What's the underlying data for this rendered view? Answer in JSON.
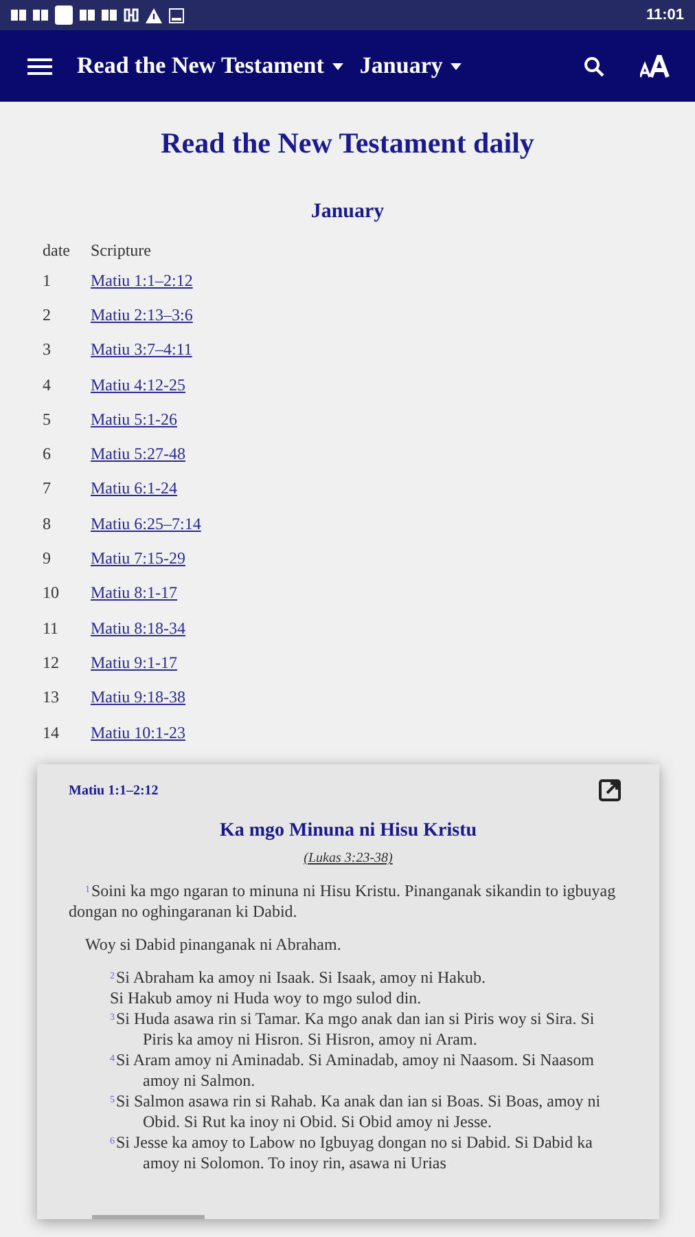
{
  "status_bar": {
    "time": "11:01"
  },
  "app_bar": {
    "title": "Read the New Testament",
    "month": "January"
  },
  "page": {
    "title": "Read the New Testament daily",
    "month": "January",
    "columns": [
      "date",
      "Scripture"
    ],
    "rows": [
      {
        "date": "1",
        "scripture": "Matiu 1:1–2:12"
      },
      {
        "date": "2",
        "scripture": "Matiu 2:13–3:6"
      },
      {
        "date": "3",
        "scripture": "Matiu 3:7–4:11"
      },
      {
        "date": "4",
        "scripture": "Matiu 4:12-25"
      },
      {
        "date": "5",
        "scripture": "Matiu 5:1-26"
      },
      {
        "date": "6",
        "scripture": "Matiu 5:27-48"
      },
      {
        "date": "7",
        "scripture": "Matiu 6:1-24"
      },
      {
        "date": "8",
        "scripture": "Matiu 6:25–7:14"
      },
      {
        "date": "9",
        "scripture": "Matiu 7:15-29"
      },
      {
        "date": "10",
        "scripture": "Matiu 8:1-17"
      },
      {
        "date": "11",
        "scripture": "Matiu 8:18-34"
      },
      {
        "date": "12",
        "scripture": "Matiu 9:1-17"
      },
      {
        "date": "13",
        "scripture": "Matiu 9:18-38"
      },
      {
        "date": "14",
        "scripture": "Matiu 10:1-23"
      }
    ]
  },
  "popup": {
    "reference": "Matiu 1:1–2:12",
    "heading": "Ka mgo Minuna ni Hisu Kristu",
    "cross_reference": "(Lukas 3:23-38)",
    "blocks": [
      {
        "kind": "paragraph",
        "verse": "1",
        "text": "Soini ka mgo ngaran to minuna ni Hisu Kristu. Pinanganak sikandin to igbuyag dongan no oghingaranan ki Dabid."
      },
      {
        "kind": "paragraph",
        "text": "Woy si Dabid pinanganak ni Abraham."
      },
      {
        "kind": "poetry",
        "verse": "2",
        "text": "Si Abraham ka amoy ni Isaak. Si Isaak, amoy ni Hakub."
      },
      {
        "kind": "poetry",
        "text": "Si Hakub amoy ni Huda woy to mgo sulod din."
      },
      {
        "kind": "poetry",
        "verse": "3",
        "text": "Si Huda asawa rin si Tamar. Ka mgo anak dan ian si Piris woy si Sira. Si Piris ka amoy ni Hisron. Si Hisron, amoy ni Aram."
      },
      {
        "kind": "poetry",
        "verse": "4",
        "text": "Si Aram amoy ni Aminadab. Si Aminadab, amoy ni Naasom. Si Naasom amoy ni Salmon."
      },
      {
        "kind": "poetry",
        "verse": "5",
        "text": "Si Salmon asawa rin si Rahab. Ka anak dan ian si Boas. Si Boas, amoy ni Obid. Si Rut ka inoy ni Obid. Si Obid amoy ni Jesse."
      },
      {
        "kind": "poetry",
        "verse": "6",
        "text": "Si Jesse ka amoy to Labow no Igbuyag dongan no si Dabid. Si Dabid ka amoy ni Solomon. To inoy rin, asawa ni Urias"
      }
    ]
  }
}
